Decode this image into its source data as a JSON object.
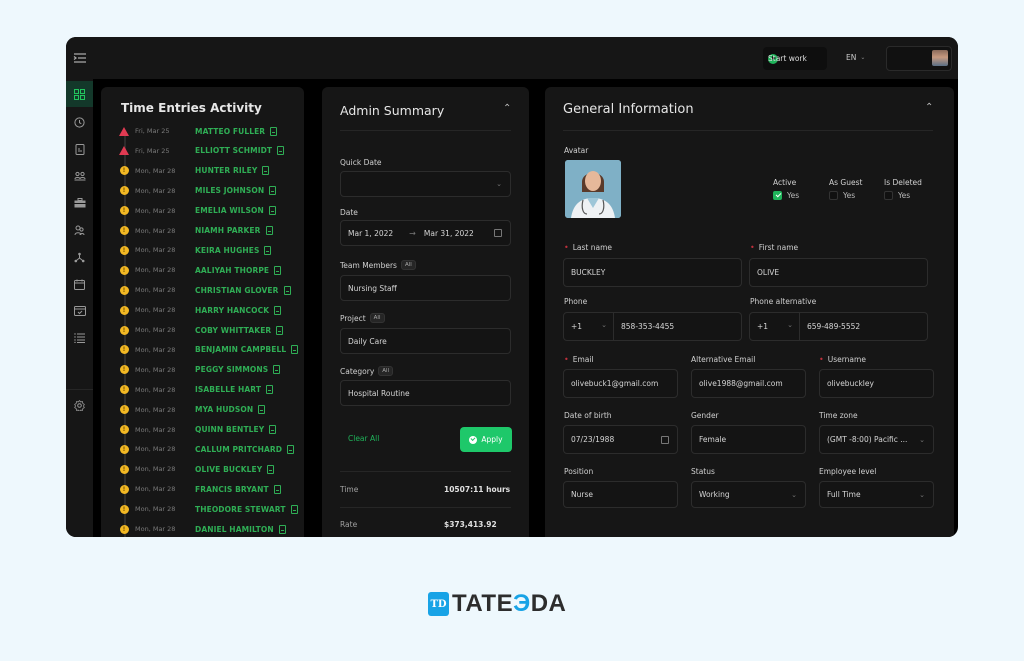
{
  "topbar": {
    "start_work_label": "Start work",
    "language": "EN"
  },
  "sidebar": {
    "items": [
      {
        "name": "dashboard",
        "icon": "grid-icon",
        "active": true
      },
      {
        "name": "time",
        "icon": "clock-icon"
      },
      {
        "name": "reports",
        "icon": "document-icon"
      },
      {
        "name": "teams",
        "icon": "users-icon"
      },
      {
        "name": "projects",
        "icon": "briefcase-icon"
      },
      {
        "name": "employees",
        "icon": "people-icon"
      },
      {
        "name": "organization",
        "icon": "hierarchy-icon"
      },
      {
        "name": "calendar",
        "icon": "calendar-icon"
      },
      {
        "name": "schedule",
        "icon": "calendar-check-icon"
      },
      {
        "name": "tasks",
        "icon": "list-icon"
      },
      {
        "name": "settings",
        "icon": "gear-icon"
      }
    ]
  },
  "time_entries": {
    "title": "Time Entries Activity",
    "entries": [
      {
        "status": "warning",
        "date": "Fri, Mar 25",
        "name": "MATTEO FULLER"
      },
      {
        "status": "warning",
        "date": "Fri, Mar 25",
        "name": "ELLIOTT SCHMIDT"
      },
      {
        "status": "pending",
        "date": "Mon, Mar 28",
        "name": "HUNTER RILEY"
      },
      {
        "status": "pending",
        "date": "Mon, Mar 28",
        "name": "MILES JOHNSON"
      },
      {
        "status": "pending",
        "date": "Mon, Mar 28",
        "name": "EMELIA WILSON"
      },
      {
        "status": "pending",
        "date": "Mon, Mar 28",
        "name": "NIAMH PARKER"
      },
      {
        "status": "pending",
        "date": "Mon, Mar 28",
        "name": "KEIRA HUGHES"
      },
      {
        "status": "pending",
        "date": "Mon, Mar 28",
        "name": "AALIYAH THORPE"
      },
      {
        "status": "pending",
        "date": "Mon, Mar 28",
        "name": "CHRISTIAN GLOVER"
      },
      {
        "status": "pending",
        "date": "Mon, Mar 28",
        "name": "HARRY HANCOCK"
      },
      {
        "status": "pending",
        "date": "Mon, Mar 28",
        "name": "COBY WHITTAKER"
      },
      {
        "status": "pending",
        "date": "Mon, Mar 28",
        "name": "BENJAMIN CAMPBELL"
      },
      {
        "status": "pending",
        "date": "Mon, Mar 28",
        "name": "PEGGY SIMMONS"
      },
      {
        "status": "pending",
        "date": "Mon, Mar 28",
        "name": "ISABELLE HART"
      },
      {
        "status": "pending",
        "date": "Mon, Mar 28",
        "name": "MYA HUDSON"
      },
      {
        "status": "pending",
        "date": "Mon, Mar 28",
        "name": "QUINN BENTLEY"
      },
      {
        "status": "pending",
        "date": "Mon, Mar 28",
        "name": "CALLUM PRITCHARD"
      },
      {
        "status": "pending",
        "date": "Mon, Mar 28",
        "name": "OLIVE BUCKLEY"
      },
      {
        "status": "pending",
        "date": "Mon, Mar 28",
        "name": "FRANCIS BRYANT"
      },
      {
        "status": "pending",
        "date": "Mon, Mar 28",
        "name": "THEODORE STEWART"
      },
      {
        "status": "pending",
        "date": "Mon, Mar 28",
        "name": "DANIEL HAMILTON"
      }
    ]
  },
  "admin_summary": {
    "title": "Admin Summary",
    "quick_date_label": "Quick Date",
    "quick_date_value": "",
    "date_label": "Date",
    "date_from": "Mar 1, 2022",
    "date_to": "Mar 31, 2022",
    "team_members_label": "Team Members",
    "team_members_badge": "All",
    "team_members_value": "Nursing Staff",
    "project_label": "Project",
    "project_badge": "All",
    "project_value": "Daily Care",
    "category_label": "Category",
    "category_badge": "All",
    "category_value": "Hospital Routine",
    "clear_all_label": "Clear All",
    "apply_label": "Apply",
    "stats": [
      {
        "label": "Time",
        "value": "10507:11 hours"
      },
      {
        "label": "Rate",
        "value": "$373,413.92"
      }
    ]
  },
  "general_info": {
    "title": "General Information",
    "avatar_label": "Avatar",
    "flags": [
      {
        "label": "Active",
        "option": "Yes",
        "checked": true
      },
      {
        "label": "As Guest",
        "option": "Yes",
        "checked": false
      },
      {
        "label": "Is Deleted",
        "option": "Yes",
        "checked": false
      }
    ],
    "last_name_label": "Last name",
    "last_name": "BUCKLEY",
    "first_name_label": "First name",
    "first_name": "OLIVE",
    "phone_label": "Phone",
    "phone_code": "+1",
    "phone": "858-353-4455",
    "phone_alt_label": "Phone alternative",
    "phone_alt_code": "+1",
    "phone_alt": "659-489-5552",
    "email_label": "Email",
    "email": "olivebuck1@gmail.com",
    "alt_email_label": "Alternative Email",
    "alt_email": "olive1988@gmail.com",
    "username_label": "Username",
    "username": "olivebuckley",
    "dob_label": "Date of birth",
    "dob": "07/23/1988",
    "gender_label": "Gender",
    "gender": "Female",
    "timezone_label": "Time zone",
    "timezone": "(GMT -8:00) Pacific ...",
    "position_label": "Position",
    "position": "Nurse",
    "status_label": "Status",
    "status": "Working",
    "level_label": "Employee level",
    "level": "Full Time"
  },
  "brand": {
    "mark": "TD",
    "name_a": "TATE",
    "name_b": "Э",
    "name_c": "DA"
  },
  "colors": {
    "accent": "#1ec86a",
    "warning": "#e03a52",
    "pending": "#f2b824",
    "brand": "#18a3e6"
  }
}
